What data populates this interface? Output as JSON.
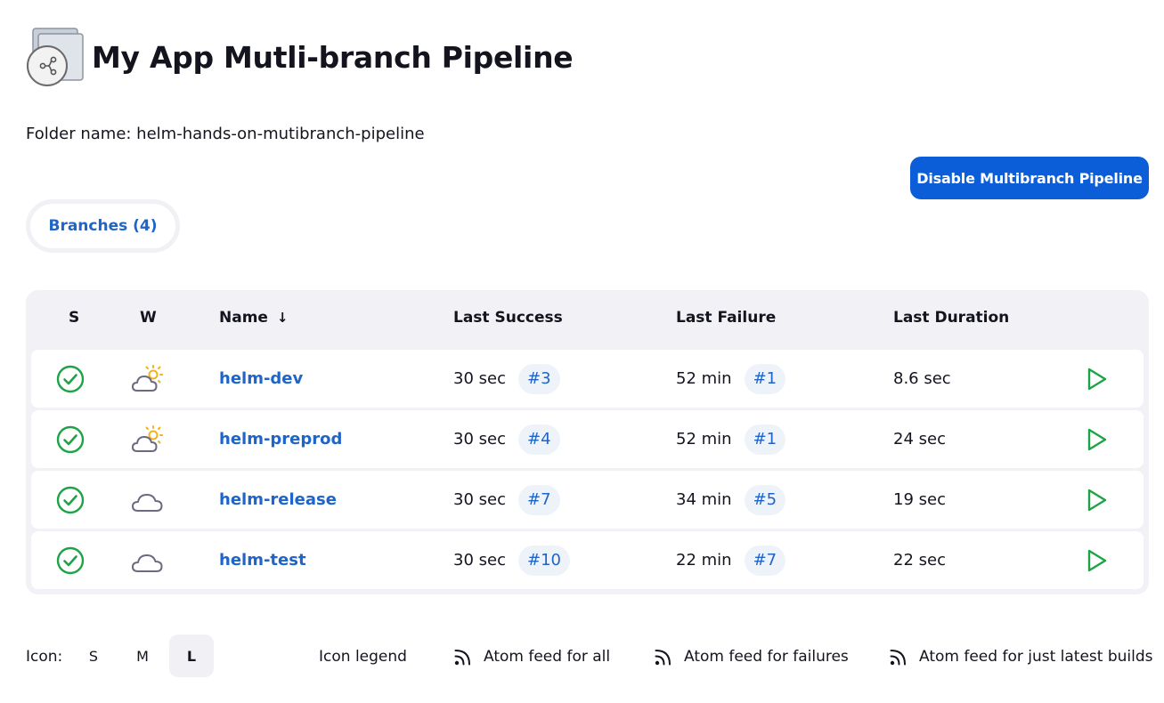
{
  "page": {
    "title": "My App Mutli-branch Pipeline",
    "folder_name": "Folder name: helm-hands-on-mutibranch-pipeline",
    "disable_button": "Disable Multibranch Pipeline",
    "tab_branches": "Branches (4)"
  },
  "table": {
    "headers": {
      "s": "S",
      "w": "W",
      "name": "Name",
      "name_sort_icon": "↓",
      "last_success": "Last Success",
      "last_failure": "Last Failure",
      "last_duration": "Last Duration"
    },
    "rows": [
      {
        "status": "success",
        "weather": "partly-sunny",
        "name": "helm-dev",
        "success_time": "30 sec",
        "success_build": "#3",
        "failure_time": "52 min",
        "failure_build": "#1",
        "duration": "8.6 sec"
      },
      {
        "status": "success",
        "weather": "partly-sunny",
        "name": "helm-preprod",
        "success_time": "30 sec",
        "success_build": "#4",
        "failure_time": "52 min",
        "failure_build": "#1",
        "duration": "24 sec"
      },
      {
        "status": "success",
        "weather": "cloudy",
        "name": "helm-release",
        "success_time": "30 sec",
        "success_build": "#7",
        "failure_time": "34 min",
        "failure_build": "#5",
        "duration": "19 sec"
      },
      {
        "status": "success",
        "weather": "cloudy",
        "name": "helm-test",
        "success_time": "30 sec",
        "success_build": "#10",
        "failure_time": "22 min",
        "failure_build": "#7",
        "duration": "22 sec"
      }
    ]
  },
  "footer": {
    "icon_label": "Icon:",
    "sizes": [
      "S",
      "M",
      "L"
    ],
    "selected_size": "L",
    "icon_legend": "Icon legend",
    "feed_all": "Atom feed for all",
    "feed_failures": "Atom feed for failures",
    "feed_latest": "Atom feed for just latest builds"
  },
  "colors": {
    "primary": "#0b5ed7",
    "link": "#1f64c8",
    "success": "#1ea446",
    "sun": "#f5b21b",
    "cloud": "#6a6a80"
  },
  "icons": {
    "folder": "folder-multibranch-icon",
    "status": "success-check-icon",
    "weather_sunny": "partly-sunny-icon",
    "weather_cloudy": "cloudy-icon",
    "run": "play-icon",
    "feed": "rss-icon"
  }
}
